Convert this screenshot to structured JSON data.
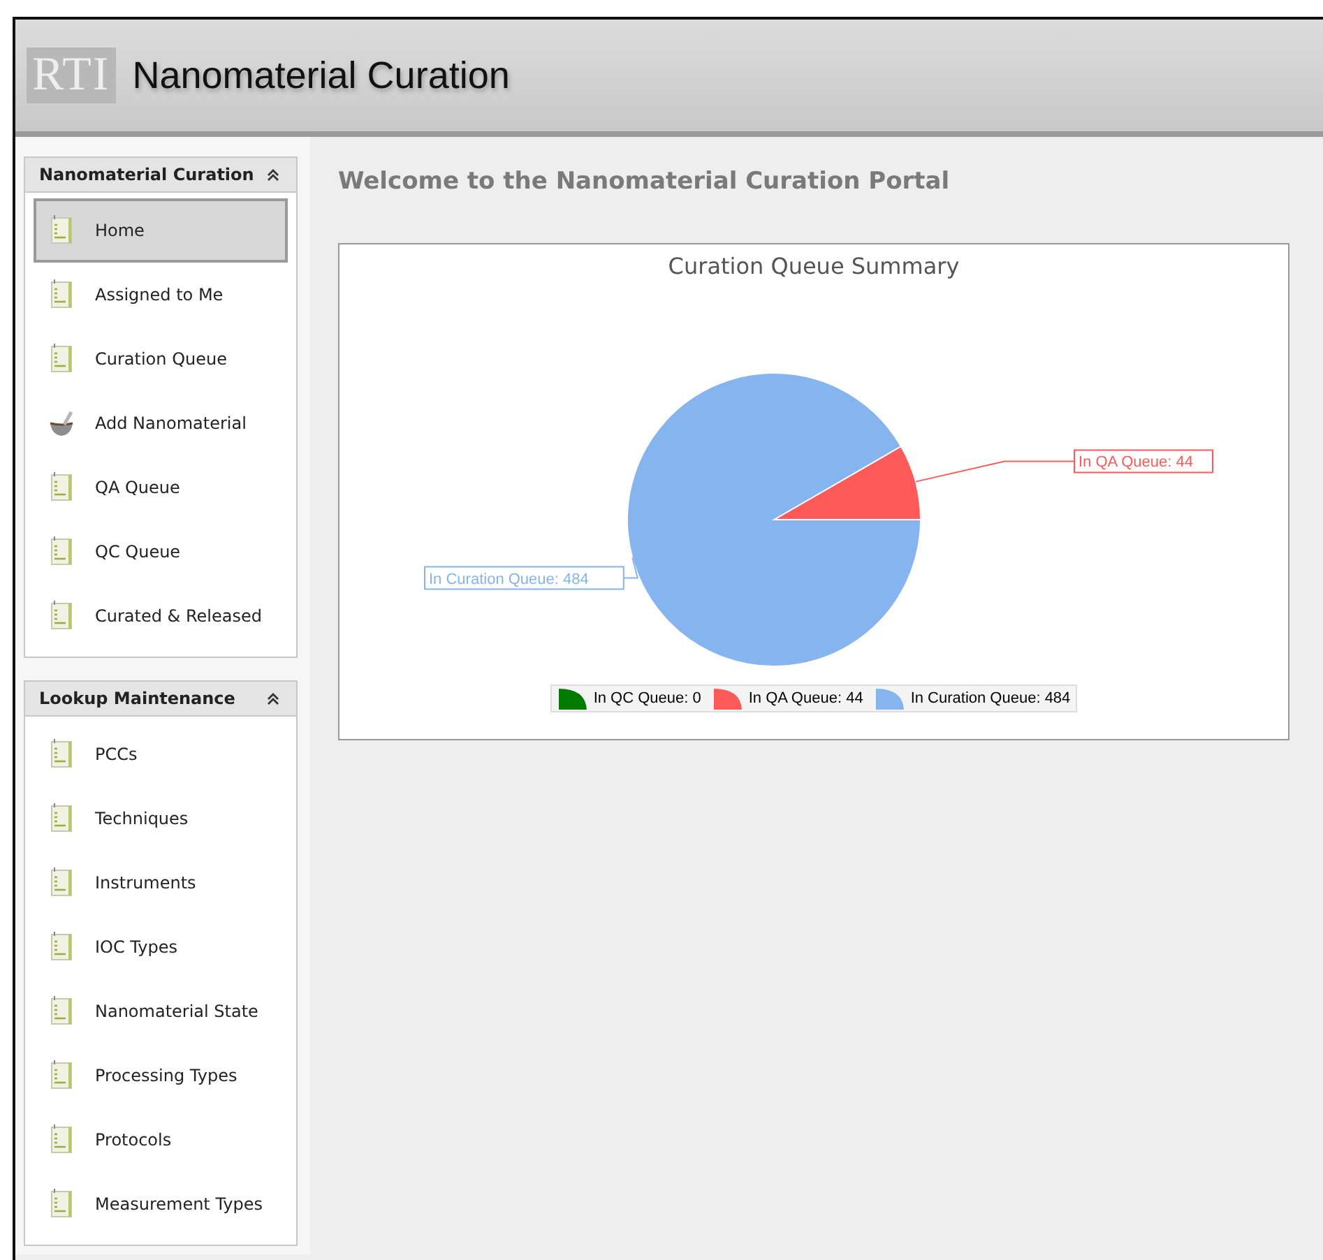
{
  "header": {
    "logo": "RTI",
    "title": "Nanomaterial Curation"
  },
  "sidebar": {
    "panels": [
      {
        "title": "Nanomaterial Curation",
        "expanded": true,
        "items": [
          {
            "label": "Home",
            "kind": "page",
            "selected": true
          },
          {
            "label": "Assigned to Me",
            "kind": "page",
            "selected": false
          },
          {
            "label": "Curation Queue",
            "kind": "page",
            "selected": false
          },
          {
            "label": "Add Nanomaterial",
            "kind": "mortar",
            "selected": false
          },
          {
            "label": "QA Queue",
            "kind": "page",
            "selected": false
          },
          {
            "label": "QC Queue",
            "kind": "page",
            "selected": false
          },
          {
            "label": "Curated & Released",
            "kind": "page",
            "selected": false
          }
        ]
      },
      {
        "title": "Lookup Maintenance",
        "expanded": true,
        "items": [
          {
            "label": "PCCs",
            "kind": "page",
            "selected": false
          },
          {
            "label": "Techniques",
            "kind": "page",
            "selected": false
          },
          {
            "label": "Instruments",
            "kind": "page",
            "selected": false
          },
          {
            "label": "IOC Types",
            "kind": "page",
            "selected": false
          },
          {
            "label": "Nanomaterial State",
            "kind": "page",
            "selected": false
          },
          {
            "label": "Processing Types",
            "kind": "page",
            "selected": false
          },
          {
            "label": "Protocols",
            "kind": "page",
            "selected": false
          },
          {
            "label": "Measurement Types",
            "kind": "page",
            "selected": false
          }
        ]
      }
    ]
  },
  "content": {
    "heading": "Welcome to the Nanomaterial Curation Portal",
    "chart_data": {
      "type": "pie",
      "title": "Curation Queue Summary",
      "categories": [
        "In QC Queue: 0",
        "In QA Queue: 44",
        "In Curation Queue: 484"
      ],
      "values": [
        0,
        44,
        484
      ],
      "legend": "bottom",
      "annotations": [
        {
          "text": "In QA Queue: 44",
          "x": "In QA Queue: 44"
        },
        {
          "text": "In Curation Queue: 484",
          "x": "In Curation Queue: 484"
        }
      ]
    },
    "legend": [
      {
        "color": "#007a00"
      },
      {
        "color": "#ff5a5a"
      },
      {
        "color": "#85b4ee"
      }
    ]
  }
}
